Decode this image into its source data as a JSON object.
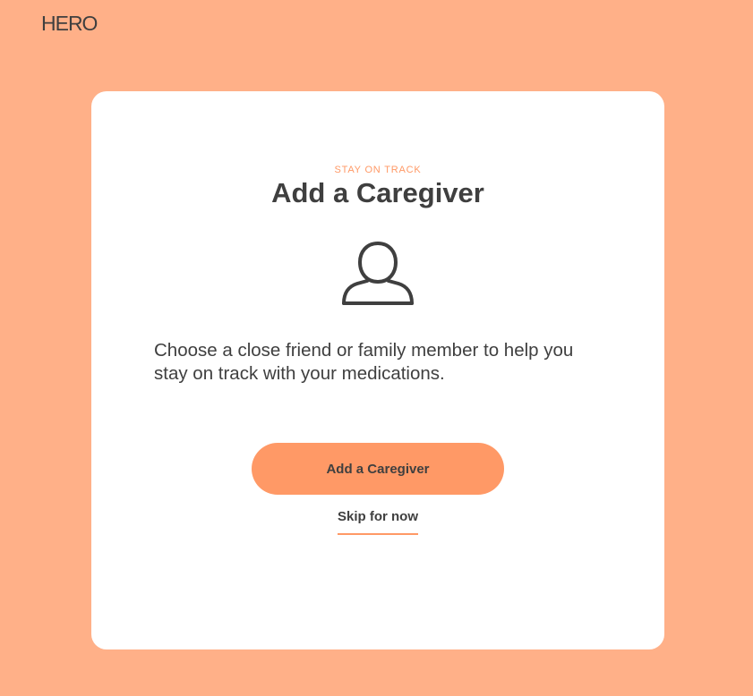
{
  "header": {
    "logo_text": "HERO"
  },
  "card": {
    "eyebrow": "STAY ON TRACK",
    "title": "Add a Caregiver",
    "icon": "person-outline-icon",
    "description": "Choose a close friend or family member to help you stay on track with your medications.",
    "primary_button_label": "Add a Caregiver",
    "skip_label": "Skip for now"
  },
  "colors": {
    "background": "#ffb088",
    "accent": "#ff9966",
    "text": "#3f3f3f",
    "card": "#ffffff"
  }
}
